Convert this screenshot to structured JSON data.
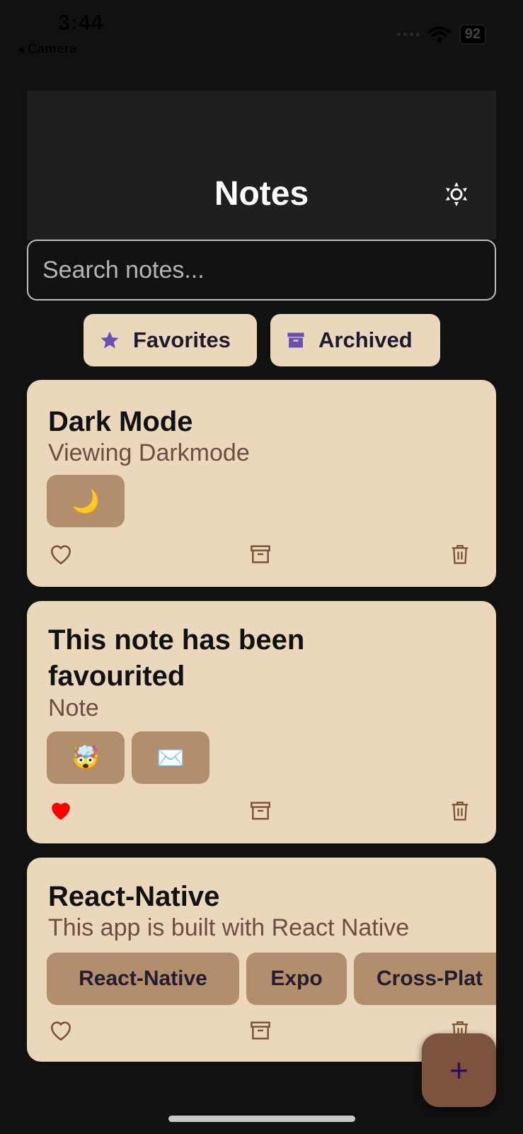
{
  "status_bar": {
    "time": "3:44",
    "back_label": "◂ Camera",
    "battery": "92"
  },
  "header": {
    "title": "Notes"
  },
  "search": {
    "placeholder": "Search notes..."
  },
  "filters": {
    "favorites_label": "Favorites",
    "archived_label": "Archived"
  },
  "notes": [
    {
      "title": "Dark Mode",
      "subtitle": "Viewing Darkmode",
      "tags": [
        "🌙"
      ],
      "favorited": false
    },
    {
      "title": "This note has been favourited",
      "subtitle": "Note",
      "tags": [
        "🤯",
        "✉️"
      ],
      "favorited": true
    },
    {
      "title": "React-Native",
      "subtitle": "This app is built with React Native",
      "tags": [
        "React-Native",
        "Expo",
        "Cross-Plat"
      ],
      "favorited": false
    }
  ],
  "fab": {
    "label": "+"
  },
  "colors": {
    "background": "#111111",
    "card": "#ead7bc",
    "tag": "#b38e6c",
    "accent": "#6a4fb0",
    "icon": "#7a5030",
    "favorite_active": "#ff0000",
    "fab": "#7b533e"
  }
}
